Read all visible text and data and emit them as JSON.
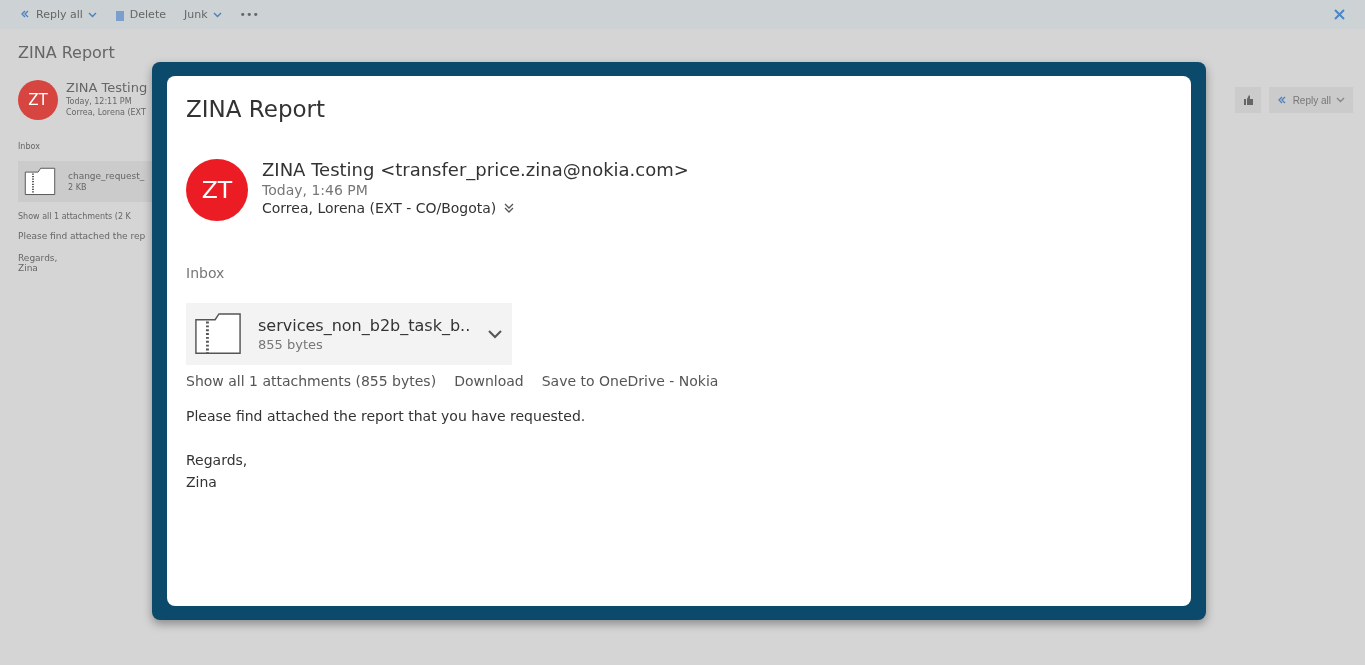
{
  "toolbar": {
    "actions": [
      {
        "kind": "reply",
        "label": "Reply all"
      },
      {
        "kind": "delete",
        "label": "Delete"
      },
      {
        "kind": "junk",
        "label": "Junk"
      },
      {
        "kind": "more",
        "label": "•••"
      }
    ]
  },
  "background_message": {
    "subject": "ZINA Report",
    "initials": "ZT",
    "sender": "ZINA Testing",
    "time": "Today, 12:11 PM",
    "recipient": "Correa, Lorena (EXT",
    "folder": "Inbox",
    "attachment": {
      "name": "change_request_",
      "size": "2 KB"
    },
    "show_all": "Show all 1 attachments (2 K",
    "body": [
      "Please find attached the rep",
      "Regards,\nZina"
    ],
    "reply_button": "Reply all"
  },
  "modal": {
    "subject": "ZINA Report",
    "initials": "ZT",
    "sender": "ZINA Testing <transfer_price.zina@nokia.com>",
    "time": "Today, 1:46 PM",
    "recipient": "Correa, Lorena (EXT - CO/Bogota)",
    "folder": "Inbox",
    "attachment": {
      "name": "services_non_b2b_task_b..",
      "size": "855 bytes"
    },
    "links": [
      "Show all 1 attachments (855 bytes)",
      "Download",
      "Save to OneDrive - Nokia"
    ],
    "body": [
      "Please find attached the report that you have requested.",
      "Regards,\nZina"
    ]
  }
}
